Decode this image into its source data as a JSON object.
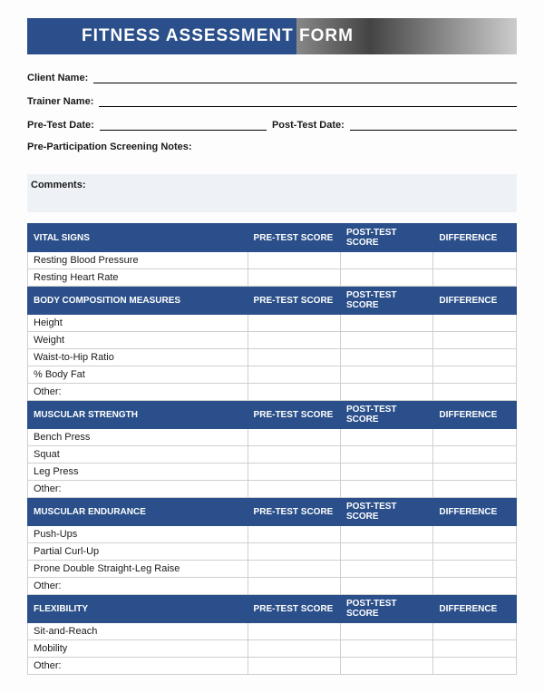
{
  "banner": {
    "title": "FITNESS ASSESSMENT FORM"
  },
  "fields": {
    "client_name_label": "Client Name:",
    "trainer_name_label": "Trainer Name:",
    "pre_test_date_label": "Pre-Test Date:",
    "post_test_date_label": "Post-Test Date:",
    "screening_notes_label": "Pre-Participation Screening Notes:",
    "comments_label": "Comments:"
  },
  "columns": {
    "pre": "PRE-TEST SCORE",
    "post": "POST-TEST SCORE",
    "diff": "DIFFERENCE"
  },
  "sections": [
    {
      "title": "VITAL SIGNS",
      "rows": [
        "Resting Blood Pressure",
        "Resting Heart Rate"
      ]
    },
    {
      "title": "BODY COMPOSITION MEASURES",
      "rows": [
        "Height",
        "Weight",
        "Waist-to-Hip Ratio",
        "% Body Fat",
        "Other:"
      ]
    },
    {
      "title": "MUSCULAR STRENGTH",
      "rows": [
        "Bench Press",
        "Squat",
        "Leg Press",
        "Other:"
      ]
    },
    {
      "title": "MUSCULAR ENDURANCE",
      "rows": [
        "Push-Ups",
        "Partial Curl-Up",
        "Prone Double Straight-Leg Raise",
        "Other:"
      ]
    },
    {
      "title": "FLEXIBILITY",
      "rows": [
        "Sit-and-Reach",
        "Mobility",
        "Other:"
      ]
    }
  ]
}
